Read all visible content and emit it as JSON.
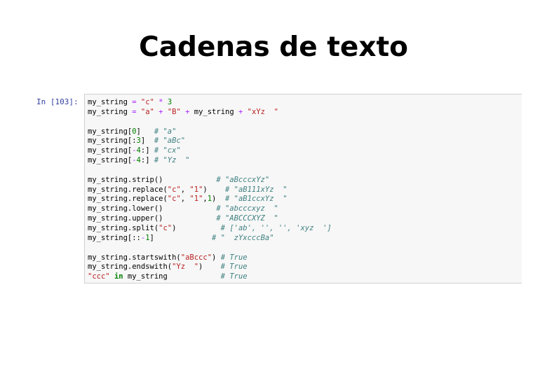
{
  "slide": {
    "title": "Cadenas de texto"
  },
  "cell": {
    "prompt": "In [103]:",
    "lines": [
      {
        "segments": [
          {
            "t": "my_string ",
            "k": ""
          },
          {
            "t": "=",
            "k": "o"
          },
          {
            "t": " ",
            "k": ""
          },
          {
            "t": "\"c\"",
            "k": "s"
          },
          {
            "t": " ",
            "k": ""
          },
          {
            "t": "*",
            "k": "o"
          },
          {
            "t": " ",
            "k": ""
          },
          {
            "t": "3",
            "k": "n"
          }
        ]
      },
      {
        "segments": [
          {
            "t": "my_string ",
            "k": ""
          },
          {
            "t": "=",
            "k": "o"
          },
          {
            "t": " ",
            "k": ""
          },
          {
            "t": "\"a\"",
            "k": "s"
          },
          {
            "t": " ",
            "k": ""
          },
          {
            "t": "+",
            "k": "o"
          },
          {
            "t": " ",
            "k": ""
          },
          {
            "t": "\"B\"",
            "k": "s"
          },
          {
            "t": " ",
            "k": ""
          },
          {
            "t": "+",
            "k": "o"
          },
          {
            "t": " my_string ",
            "k": ""
          },
          {
            "t": "+",
            "k": "o"
          },
          {
            "t": " ",
            "k": ""
          },
          {
            "t": "\"xYz  \"",
            "k": "s"
          }
        ]
      },
      {
        "segments": []
      },
      {
        "segments": [
          {
            "t": "my_string[",
            "k": ""
          },
          {
            "t": "0",
            "k": "n"
          },
          {
            "t": "]   ",
            "k": ""
          },
          {
            "t": "# \"a\"",
            "k": "c"
          }
        ]
      },
      {
        "segments": [
          {
            "t": "my_string[:",
            "k": ""
          },
          {
            "t": "3",
            "k": "n"
          },
          {
            "t": "]  ",
            "k": ""
          },
          {
            "t": "# \"aBc\"",
            "k": "c"
          }
        ]
      },
      {
        "segments": [
          {
            "t": "my_string[",
            "k": ""
          },
          {
            "t": "-",
            "k": "o"
          },
          {
            "t": "4",
            "k": "n"
          },
          {
            "t": ":] ",
            "k": ""
          },
          {
            "t": "# \"cx\"",
            "k": "c"
          }
        ]
      },
      {
        "segments": [
          {
            "t": "my_string[",
            "k": ""
          },
          {
            "t": "-",
            "k": "o"
          },
          {
            "t": "4",
            "k": "n"
          },
          {
            "t": ":] ",
            "k": ""
          },
          {
            "t": "# \"Yz  \"",
            "k": "c"
          }
        ]
      },
      {
        "segments": []
      },
      {
        "segments": [
          {
            "t": "my_string.strip()            ",
            "k": ""
          },
          {
            "t": "# \"aBcccxYz\"",
            "k": "c"
          }
        ]
      },
      {
        "segments": [
          {
            "t": "my_string.replace(",
            "k": ""
          },
          {
            "t": "\"c\"",
            "k": "s"
          },
          {
            "t": ", ",
            "k": ""
          },
          {
            "t": "\"1\"",
            "k": "s"
          },
          {
            "t": ")    ",
            "k": ""
          },
          {
            "t": "# \"aB111xYz  \"",
            "k": "c"
          }
        ]
      },
      {
        "segments": [
          {
            "t": "my_string.replace(",
            "k": ""
          },
          {
            "t": "\"c\"",
            "k": "s"
          },
          {
            "t": ", ",
            "k": ""
          },
          {
            "t": "\"1\"",
            "k": "s"
          },
          {
            "t": ",",
            "k": ""
          },
          {
            "t": "1",
            "k": "n"
          },
          {
            "t": ")  ",
            "k": ""
          },
          {
            "t": "# \"aB1ccxYz  \"",
            "k": "c"
          }
        ]
      },
      {
        "segments": [
          {
            "t": "my_string.lower()            ",
            "k": ""
          },
          {
            "t": "# \"abcccxyz  \"",
            "k": "c"
          }
        ]
      },
      {
        "segments": [
          {
            "t": "my_string.upper()            ",
            "k": ""
          },
          {
            "t": "# \"ABCCCXYZ  \"",
            "k": "c"
          }
        ]
      },
      {
        "segments": [
          {
            "t": "my_string.split(",
            "k": ""
          },
          {
            "t": "\"c\"",
            "k": "s"
          },
          {
            "t": ")          ",
            "k": ""
          },
          {
            "t": "# ['ab', '', '', 'xyz  ']",
            "k": "c"
          }
        ]
      },
      {
        "segments": [
          {
            "t": "my_string[::",
            "k": ""
          },
          {
            "t": "-",
            "k": "o"
          },
          {
            "t": "1",
            "k": "n"
          },
          {
            "t": "]             ",
            "k": ""
          },
          {
            "t": "# \"  zYxcccBa\"",
            "k": "c"
          }
        ]
      },
      {
        "segments": []
      },
      {
        "segments": [
          {
            "t": "my_string.startswith(",
            "k": ""
          },
          {
            "t": "\"aBccc\"",
            "k": "s"
          },
          {
            "t": ") ",
            "k": ""
          },
          {
            "t": "# True",
            "k": "c"
          }
        ]
      },
      {
        "segments": [
          {
            "t": "my_string.endswith(",
            "k": ""
          },
          {
            "t": "\"Yz  \"",
            "k": "s"
          },
          {
            "t": ")    ",
            "k": ""
          },
          {
            "t": "# True",
            "k": "c"
          }
        ]
      },
      {
        "segments": [
          {
            "t": "\"ccc\"",
            "k": "s"
          },
          {
            "t": " ",
            "k": ""
          },
          {
            "t": "in",
            "k": "k"
          },
          {
            "t": " my_string            ",
            "k": ""
          },
          {
            "t": "# True",
            "k": "c"
          }
        ]
      }
    ]
  }
}
